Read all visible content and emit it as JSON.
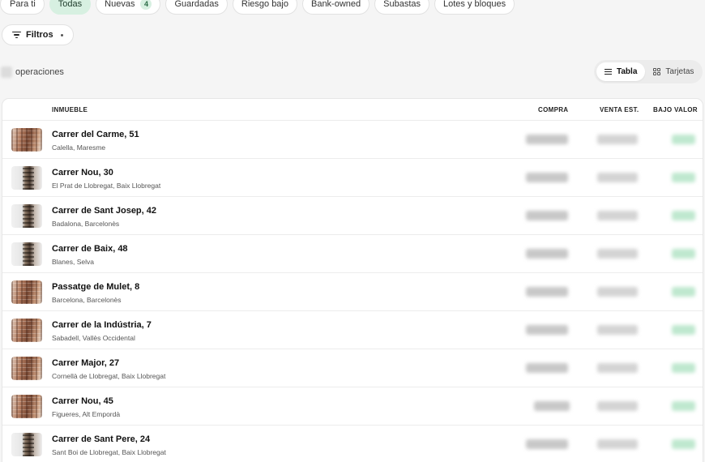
{
  "chips": [
    {
      "label": "Para ti",
      "active": false
    },
    {
      "label": "Todas",
      "active": true
    },
    {
      "label": "Nuevas",
      "active": false,
      "badge": "4"
    },
    {
      "label": "Guardadas",
      "active": false
    },
    {
      "label": "Riesgo bajo",
      "active": false
    },
    {
      "label": "Bank-owned",
      "active": false
    },
    {
      "label": "Subastas",
      "active": false
    },
    {
      "label": "Lotes y bloques",
      "active": false
    }
  ],
  "filters": {
    "label": "Filtros"
  },
  "operations": {
    "label": "operaciones"
  },
  "view_toggle": {
    "table_label": "Tabla",
    "cards_label": "Tarjetas",
    "active": "table"
  },
  "table": {
    "headers": {
      "property": "INMUEBLE",
      "buy": "COMPRA",
      "sale": "VENTA EST.",
      "low_value": "BAJO VALOR"
    },
    "rows": [
      {
        "address": "Carrer del Carme, 51",
        "location": "Calella, Maresme",
        "thumb": "warm"
      },
      {
        "address": "Carrer Nou, 30",
        "location": "El Prat de Llobregat, Baix Llobregat",
        "thumb": "gray"
      },
      {
        "address": "Carrer de Sant Josep, 42",
        "location": "Badalona, Barcelonès",
        "thumb": "gray"
      },
      {
        "address": "Carrer de Baix, 48",
        "location": "Blanes, Selva",
        "thumb": "gray"
      },
      {
        "address": "Passatge de Mulet, 8",
        "location": "Barcelona, Barcelonès",
        "thumb": "warm"
      },
      {
        "address": "Carrer de la Indústria, 7",
        "location": "Sabadell, Vallès Occidental",
        "thumb": "warm"
      },
      {
        "address": "Carrer Major, 27",
        "location": "Cornellà de Llobregat, Baix Llobregat",
        "thumb": "warm"
      },
      {
        "address": "Carrer Nou, 45",
        "location": "Figueres, Alt Empordà",
        "thumb": "warm"
      },
      {
        "address": "Carrer de Sant Pere, 24",
        "location": "Sant Boi de Llobregat, Baix Llobregat",
        "thumb": "gray"
      }
    ]
  },
  "colors": {
    "accent_bg": "#d7f0e1",
    "accent_text": "#2a6b45",
    "page_bg": "#f5f5f5"
  }
}
